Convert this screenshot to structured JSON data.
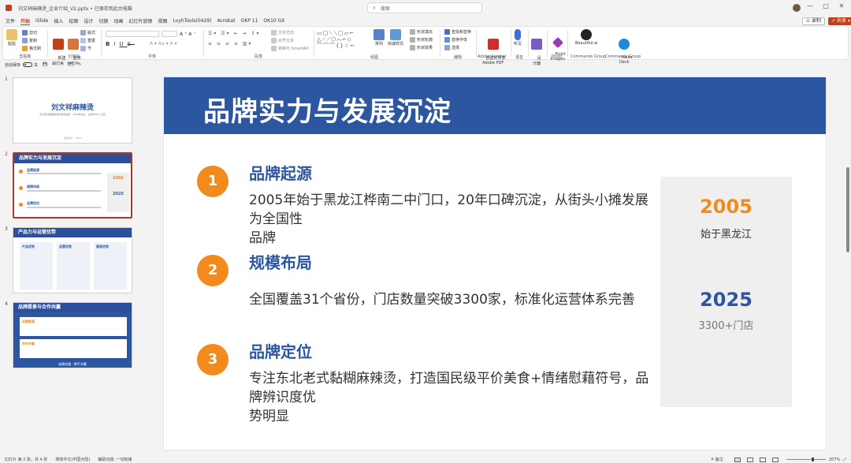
{
  "titlebar": {
    "title": "刘文祥麻辣烫_企业介绍_V2.pptx • 已保存到此台电脑",
    "search_placeholder": "搜索",
    "minimize": "—",
    "maximize": "□",
    "close": "✕"
  },
  "menu": {
    "tabs": [
      "文件",
      "开始",
      "iSlide",
      "插入",
      "绘图",
      "设计",
      "切换",
      "动画",
      "幻灯片放映",
      "视图",
      "LvyhTools(0429)",
      "Acrobat",
      "OKP 11",
      "OK10 GX"
    ],
    "active": "开始",
    "record_label": "⊙ 录制",
    "share_label": "↗ 共享 ▾"
  },
  "ribbon": {
    "clipboard": {
      "paste": "粘贴",
      "cut": "剪切",
      "copy": "复制",
      "painter": "格式刷",
      "label": "剪贴板"
    },
    "slides": {
      "new_slide": "新建\n幻灯片",
      "reuse": "重用\n幻灯片",
      "layout": "版式",
      "reset": "重置",
      "section": "节",
      "label": "幻灯片"
    },
    "font": {
      "font_name": "",
      "font_size": "",
      "bold": "B",
      "italic": "I",
      "underline": "U",
      "strike": "S",
      "label": "字体"
    },
    "paragraph": {
      "label": "段落",
      "text_direction": "文字方向",
      "align_text": "对齐文本",
      "smartart": "转换为 SmartArt"
    },
    "drawing": {
      "shape_rows": [
        "▭▢⟍⟍▢▱⌐",
        "△⟋⟋⬠⌒⌐⬦",
        "⌒⌒⌒{}☆⌐"
      ],
      "arrange": "排列",
      "quick_styles": "快速样式",
      "shape_fill": "形状填充",
      "shape_outline": "形状轮廓",
      "shape_effects": "形状效果",
      "label": "绘图"
    },
    "editing": {
      "find": "查找和替换",
      "replace_font": "替换字体",
      "select": "选择",
      "label": "编辑"
    },
    "acrobat": {
      "create_share": "创建并共享\nAdobe PDF",
      "label": "Adobe Acrobat"
    },
    "voice": {
      "dictate": "听写",
      "label": "语音"
    },
    "designer": {
      "design": "设\n计器"
    },
    "pickit": {
      "images": "Pickit\nImages",
      "label": "Pickit"
    },
    "beautiful": {
      "name": "Beautiful.ai",
      "label": "Commands Group"
    },
    "haiku": {
      "name": "Haiku\nDeck",
      "label": "Commands Group"
    },
    "colors": {
      "paste": "#e8c36a",
      "cut": "#6a7fb5",
      "copy": "#8aa0c8",
      "painter": "#d9a441",
      "new_slide": "#c43e1c",
      "reuse": "#d97441",
      "layout": "#9aa9c9",
      "reset": "#b9c4da",
      "section": "#a7b4cf",
      "arrange": "#5b7fc4",
      "quick_styles": "#5e9ad6",
      "find": "#3c74c9",
      "acrobat": "#d32c2c",
      "dictate": "#3b6fd4",
      "designer": "#7d5bc4",
      "pickit": "#9b3bb5",
      "beautiful": "#222222",
      "haiku": "#1d8bd4"
    }
  },
  "qat": {
    "autosave": "自动保存",
    "off": "关",
    "items": [
      "💾",
      "↶",
      "↷",
      "🗂",
      "✎"
    ]
  },
  "thumbnails": [
    {
      "num": "1",
      "title": "刘文祥麻辣烫",
      "subtitle": "东北老式黏糊麻辣烫领导品牌 · 2005年创立 · 全国3300+门店",
      "footer": "企业简介 · 2024"
    },
    {
      "num": "2",
      "title": "品牌实力与发展沉淀",
      "items": [
        "品牌起源",
        "规模布局",
        "品牌定位"
      ],
      "years": [
        "2005",
        "2025"
      ]
    },
    {
      "num": "3",
      "title": "产品力与运营优势",
      "columns": [
        "产品优势",
        "运营优势",
        "渠道优势"
      ]
    },
    {
      "num": "4",
      "title": "品牌愿景与合作共赢",
      "boxes": [
        "品牌愿景",
        "合作共赢"
      ],
      "footer": "诚邀加盟 · 携手共赢"
    }
  ],
  "slide": {
    "title": "品牌实力与发展沉淀",
    "items": [
      {
        "num": "1",
        "heading": "品牌起源",
        "body": "2005年始于黑龙江桦南二中门口，20年口碑沉淀，从街头小摊发展为全国性\n品牌"
      },
      {
        "num": "2",
        "heading": "规模布局",
        "body": "全国覆盖31个省份，门店数量突破3300家，标准化运营体系完善"
      },
      {
        "num": "3",
        "heading": "品牌定位",
        "body": "专注东北老式黏糊麻辣烫，打造国民级平价美食+情绪慰藉符号，品牌辨识度优\n势明显"
      }
    ],
    "sidebox": [
      {
        "year": "2005",
        "caption": "始于黑龙江"
      },
      {
        "year": "2025",
        "caption": "3300+门店"
      }
    ],
    "colors": {
      "header": "#2c57a0",
      "accent": "#f28a1e",
      "heading": "#2c57a0",
      "year_2005": "#f28a1e",
      "year_2025": "#2c57a0"
    }
  },
  "status": {
    "slide_info": "幻灯片 第 2 张，共 4 张",
    "language": "简体中文(中国大陆)",
    "accessibility": "辅助功能: 一切就绪",
    "notes": "≜ 备注",
    "zoom": "207%",
    "fit_icon": "⤢"
  }
}
